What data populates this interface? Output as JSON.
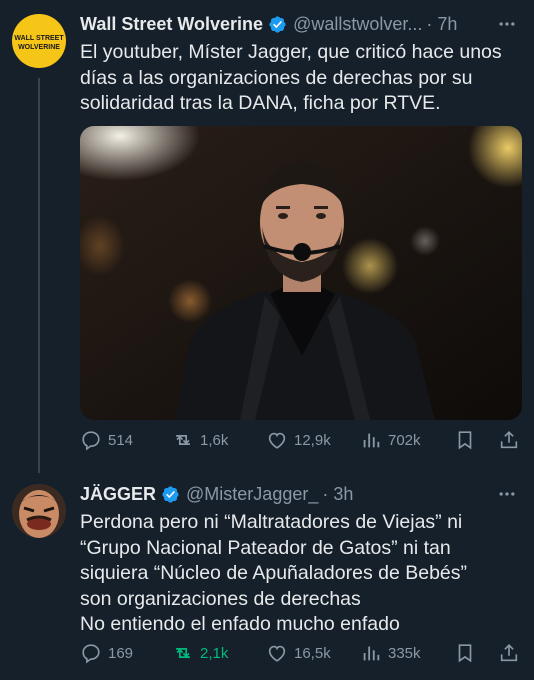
{
  "tweet1": {
    "display_name": "Wall Street Wolverine",
    "handle": "@wallstwolver...",
    "time": "· 7h",
    "avatar_text": "WALL STREET\nWOLVERINE",
    "text": "El youtuber, Míster Jagger, que criticó hace unos días a las organizaciones de derechas por su solidaridad tras la DANA, ficha por RTVE.",
    "actions": {
      "replies": "514",
      "retweets": "1,6k",
      "likes": "12,9k",
      "views": "702k"
    }
  },
  "tweet2": {
    "display_name": "JÄGGER",
    "handle": "@MisterJagger_",
    "time": "· 3h",
    "text": "Perdona pero ni “Maltratadores de Viejas” ni\n“Grupo Nacional Pateador de Gatos” ni tan\nsiquiera “Núcleo de Apuñaladores de Bebés”\nson organizaciones de derechas\nNo entiendo el enfado mucho enfado",
    "actions": {
      "replies": "169",
      "retweets": "2,1k",
      "likes": "16,5k",
      "views": "335k"
    }
  },
  "colors": {
    "background": "#15202b",
    "verified": "#1d9bf0",
    "secondary_text": "#8b98a5",
    "retweet_active": "#00ba7c",
    "wsw_avatar": "#f5c518"
  },
  "icons": [
    "verified-badge-icon",
    "more-icon",
    "reply-icon",
    "retweet-icon",
    "like-icon",
    "views-icon",
    "bookmark-icon",
    "share-icon"
  ]
}
